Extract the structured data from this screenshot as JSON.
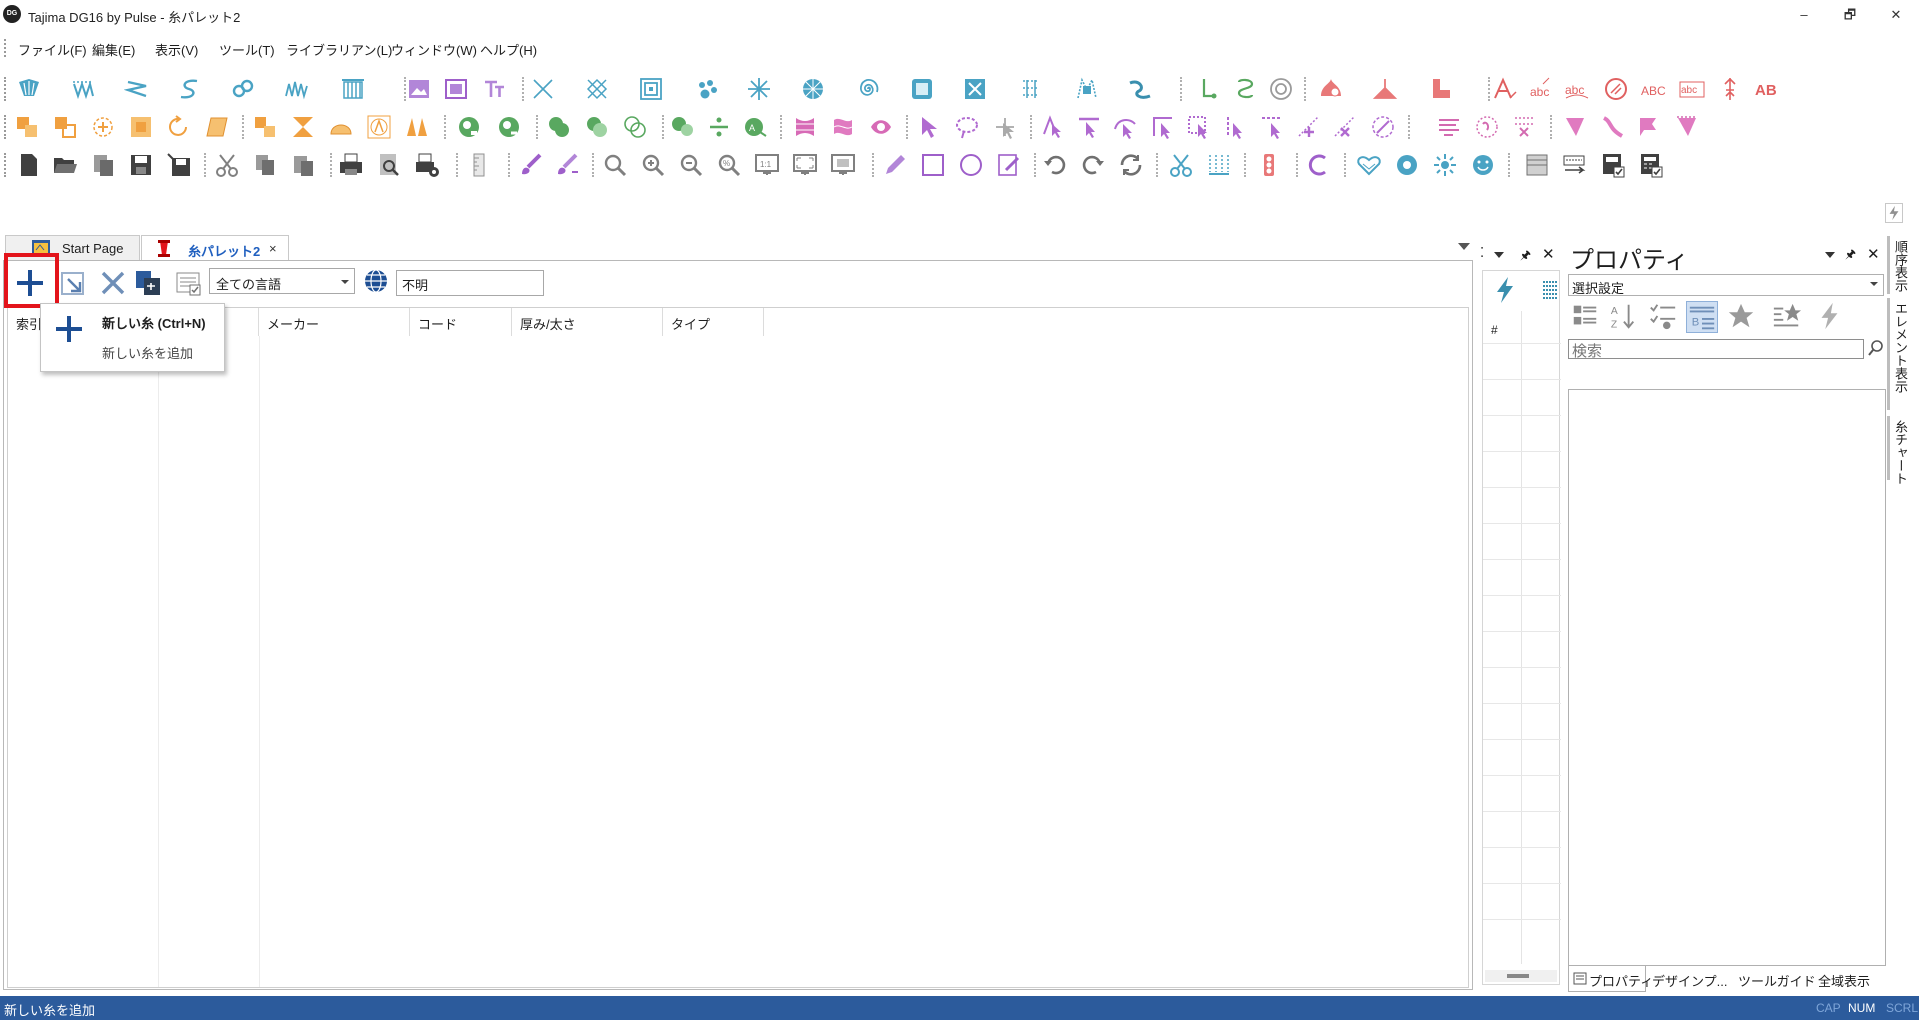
{
  "window": {
    "app_icon_text": "DG",
    "title": "Tajima DG16 by Pulse - 糸パレット2",
    "controls": [
      "–",
      "🗗",
      "✕"
    ]
  },
  "menu": [
    "ファイル(F)",
    "編集(E)",
    "表示(V)",
    "ツール(T)",
    "ライブラリアン(L)",
    "ウィンドウ(W)",
    "ヘルプ(H)"
  ],
  "tabs": {
    "start": "Start Page",
    "palette": "糸パレット2",
    "close": "×"
  },
  "doc_toolbar": {
    "language": "全ての言語",
    "unknown_value": "不明"
  },
  "grid": {
    "columns": [
      "索引",
      "",
      "メーカー",
      "コード",
      "厚み/太さ",
      "タイプ"
    ]
  },
  "tooltip": {
    "title": "新しい糸 (Ctrl+N)",
    "description": "新しい糸を追加"
  },
  "middle_pane": {
    "column_header": "#"
  },
  "properties": {
    "title": "プロパティ",
    "select_value": "選択設定",
    "search_placeholder": "検索",
    "bottom_tabs": [
      "プロパティ",
      "デザインプ...",
      "ツールガイド",
      "全域表示"
    ]
  },
  "side_tabs": [
    "順序表示",
    "エレメント表示",
    "糸チャート"
  ],
  "statusbar": {
    "text": "新しい糸を追加",
    "caps": "CAP",
    "num": "NUM",
    "scroll": "SCRL"
  },
  "colors": {
    "accent_blue": "#2c5b9c",
    "highlight_red": "#e3141b",
    "digitize_blue": "#4aa3c4",
    "edit_orange": "#f0a040",
    "select_purple": "#b06ad0",
    "text_red": "#e06060"
  }
}
